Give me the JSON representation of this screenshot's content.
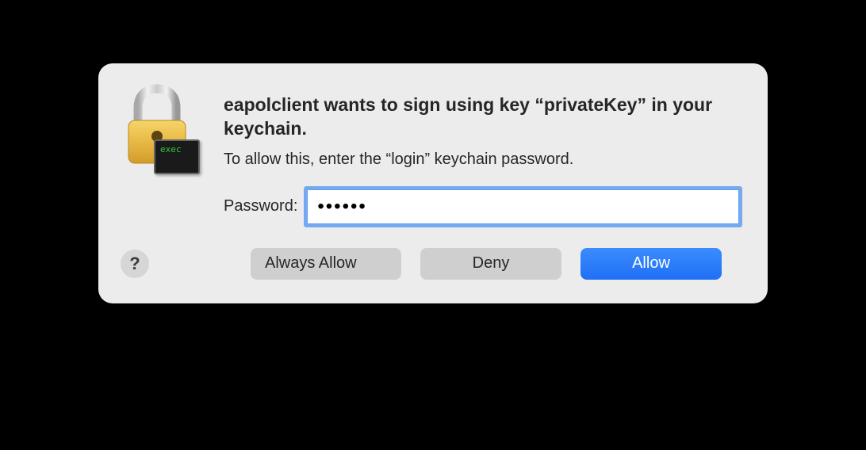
{
  "dialog": {
    "heading": "eapolclient wants to sign using key “privateKey” in your keychain.",
    "subtext": "To allow this, enter the “login” keychain password.",
    "password_label": "Password:",
    "password_value": "••••••",
    "exec_badge": "exec",
    "help_label": "?",
    "buttons": {
      "always_allow": "Always Allow",
      "deny": "Deny",
      "allow": "Allow"
    }
  }
}
